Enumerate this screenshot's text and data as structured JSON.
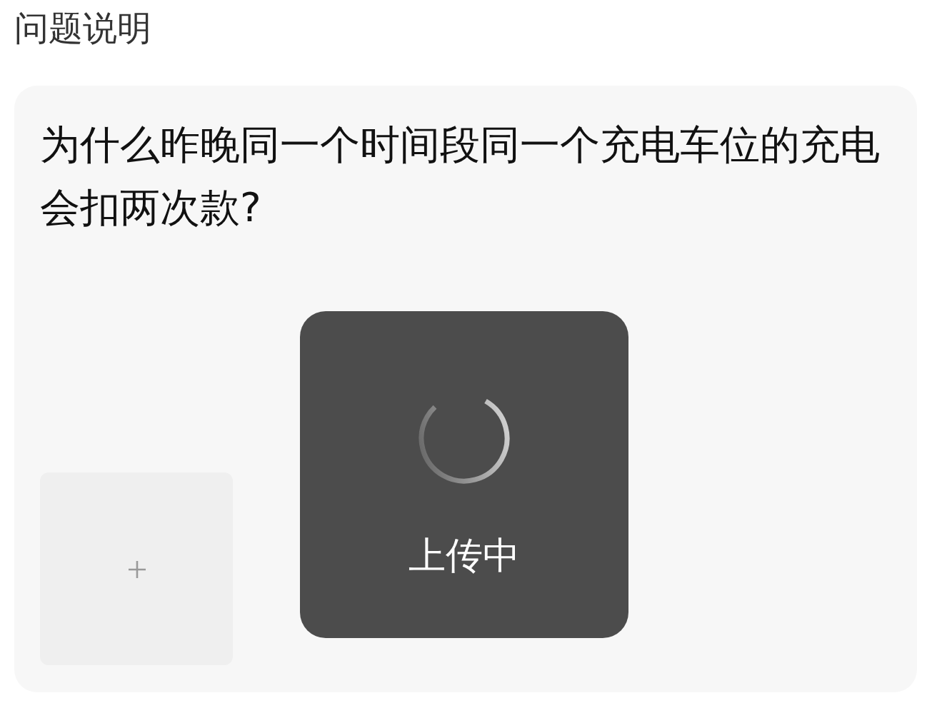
{
  "section_title": "问题说明",
  "question": "为什么昨晚同一个时间段同一个充电车位的充电会扣两次款?",
  "toast": {
    "text": "上传中"
  }
}
